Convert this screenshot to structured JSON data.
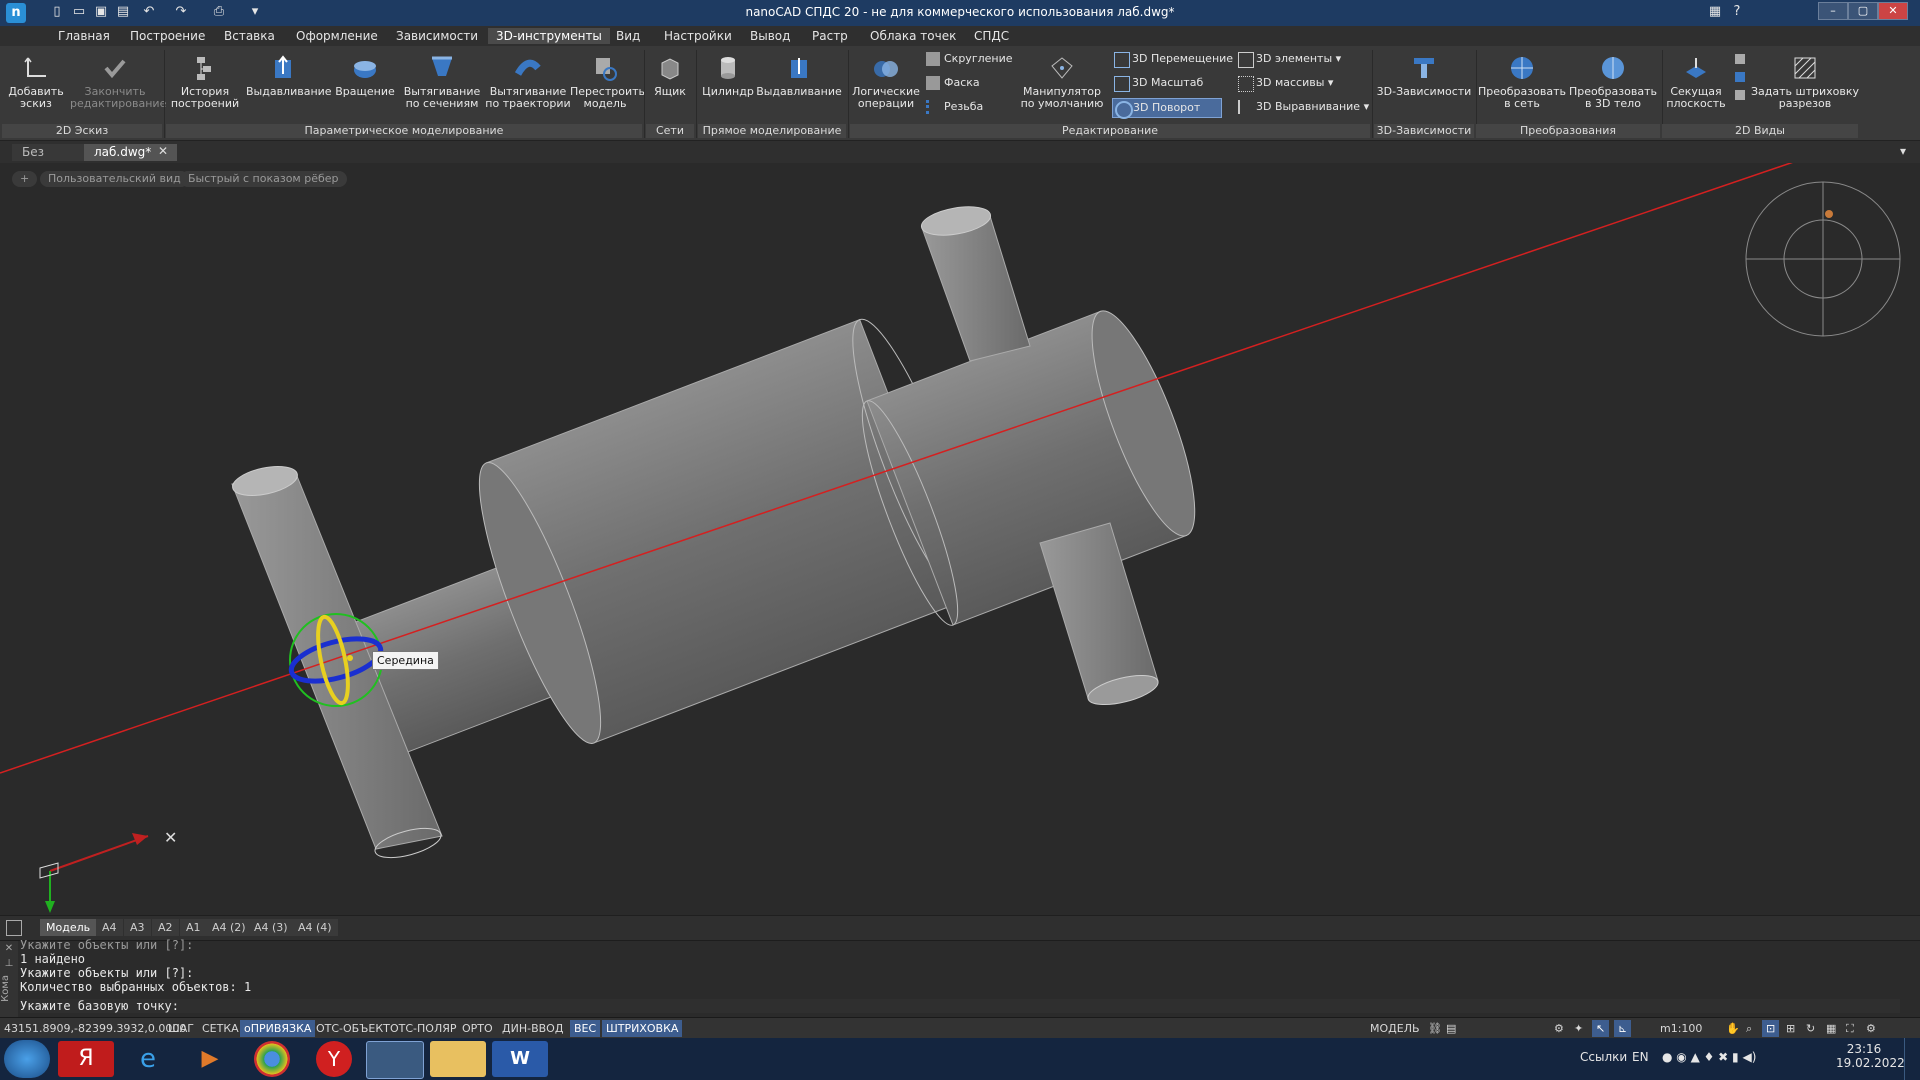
{
  "titlebar": {
    "title": "nanoCAD СПДС 20 - не для коммерческого использования лаб.dwg*"
  },
  "menu": {
    "tabs": [
      "Главная",
      "Построение",
      "Вставка",
      "Оформление",
      "Зависимости",
      "3D-инструменты",
      "Вид",
      "Настройки",
      "Вывод",
      "Растр",
      "Облака точек",
      "СПДС"
    ],
    "active_index": 5
  },
  "ribbon": {
    "add_sketch": "Добавить эскиз",
    "finish_edit": "Закончить редактирование",
    "history": "История построений",
    "extrude": "Выдавливание",
    "revolve": "Вращение",
    "loft": "Вытягивание по сечениям",
    "sweep": "Вытягивание по траектории",
    "rebuild": "Перестроить модель",
    "box": "Ящик",
    "cylinder": "Цилиндр",
    "extrude2": "Выдавливание",
    "boolean": "Логические операции",
    "fillet": "Скругление",
    "chamfer": "Фаска",
    "thread": "Резьба",
    "manipulator": "Манипулятор по умолчанию",
    "move3d": "3D Перемещение",
    "scale3d": "3D Масштаб",
    "rotate3d": "3D Поворот",
    "elements3d": "3D элементы",
    "arrays3d": "3D массивы",
    "align3d": "3D Выравнивание",
    "constraints3d": "3D-Зависимости",
    "to_mesh": "Преобразовать в сеть",
    "to_solid": "Преобразовать в 3D тело",
    "section_plane": "Секущая плоскость",
    "hatch_sections": "Задать штриховку разрезов",
    "groups": {
      "sketch2d": "2D Эскиз",
      "param": "Параметрическое моделирование",
      "mesh": "Сети",
      "direct": "Прямое моделирование",
      "edit": "Редактирование",
      "constraints3d": "3D-Зависимости",
      "transform": "Преобразования",
      "views2d": "2D Виды"
    }
  },
  "doctabs": {
    "tab1": "Без имени",
    "tab2": "лаб.dwg*"
  },
  "viewport": {
    "tag_plus": "+",
    "tag_view": "Пользовательский вид",
    "tag_style": "Быстрый с показом рёбер",
    "snap_tooltip": "Середина"
  },
  "layout_tabs": [
    "Модель",
    "A4",
    "A3",
    "A2",
    "A1",
    "A4 (2)",
    "A4 (3)",
    "A4 (4)"
  ],
  "command_lines": [
    "Укажите объекты или [?]:",
    "1 найдено",
    "Укажите объекты или [?]:",
    "Количество выбранных объектов: 1",
    "Укажите базовую точку:"
  ],
  "command_side": "Кома",
  "status": {
    "coords": "43151.8909,-82399.3932,0.0000",
    "items": [
      "ШАГ",
      "СЕТКА",
      "оПРИВЯЗКА",
      "ОТС-ОБЪЕКТ",
      "ОТС-ПОЛЯР",
      "ОРТО",
      "ДИН-ВВОД",
      "ВЕС",
      "ШТРИХОВКА"
    ],
    "on_items": [
      "оПРИВЯЗКА",
      "ВЕС",
      "ШТРИХОВКА"
    ],
    "model": "МОДЕЛЬ",
    "scale": "m1:100"
  },
  "taskbar": {
    "links": "Ссылки",
    "lang": "EN",
    "time": "23:16",
    "date": "19.02.2022"
  },
  "colors": {
    "accent": "#3d5d8f",
    "title_bg": "#1e3b62",
    "axis_line": "#d42020"
  }
}
